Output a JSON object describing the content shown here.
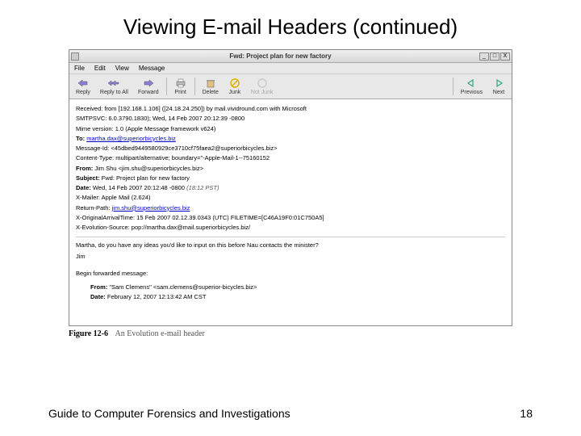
{
  "slide": {
    "title": "Viewing E-mail Headers (continued)",
    "footer_text": "Guide to Computer Forensics and Investigations",
    "page_number": "18"
  },
  "window": {
    "title": "Fwd: Project plan for new factory",
    "min": "_",
    "max": "□",
    "close": "X"
  },
  "menu": {
    "file": "File",
    "edit": "Edit",
    "view": "View",
    "message": "Message"
  },
  "toolbar": {
    "reply": "Reply",
    "reply_all": "Reply to All",
    "forward": "Forward",
    "print": "Print",
    "delete": "Delete",
    "junk": "Junk",
    "not_junk": "Not Junk",
    "previous": "Previous",
    "next": "Next"
  },
  "headers": {
    "received": "Received: from [192.168.1.106] ([24.18.24.250]) by mail.vividround.com with Microsoft",
    "smtpsvc": "SMTPSVC: 6.0.3790.1830); Wed, 14 Feb 2007 20:12:39 -0800",
    "mime": "Mime version: 1.0 (Apple Message framework v624)",
    "to_label": "To:",
    "to_value": "martha.dax@superiorbicycles.biz",
    "msgid": "Message-Id: <45dbed9449580929ce3710cf75faea2@superiorbicycles.biz>",
    "ctype": "Content-Type: multipart/alternative; boundary=\"-Apple-Mail-1--75160152",
    "from_label": "From:",
    "from_value": "Jim Shu <jim.shu@superiorbicycles.biz>",
    "subj_label": "Subject:",
    "subj_value": "Fwd: Project plan for new factory",
    "date_label": "Date:",
    "date_value": "Wed, 14 Feb 2007 20:12:48 -0800",
    "date_note": "(18:12 PST)",
    "xmailer": "X-Mailer: Apple Mail (2.624)",
    "retpath_label": "Return-Path:",
    "retpath_value": "jim.shu@superiorbicycles.biz",
    "xorig": "X-OriginalArrivalTime: 15 Feb 2007 02.12.39.0343 (UTC) FILETIME=[C46A19F0:01C750A5]",
    "xevo": "X-Evolution-Source: pop://martha.dax@mail.superiorbicycles.biz/"
  },
  "body": {
    "line1": "Martha, do you have any ideas you'd like to input on this before Nau contacts the minister?",
    "line2": "Jim",
    "fwd_begin": "Begin forwarded message:",
    "fwd_from_label": "From:",
    "fwd_from_value": "\"Sam Clemens\" <sam.clemens@superior-bicycles.biz>",
    "fwd_date_label": "Date:",
    "fwd_date_value": "February 12, 2007 12:13:42 AM CST"
  },
  "caption": {
    "number": "Figure 12-6",
    "text": "An Evolution e-mail header"
  }
}
